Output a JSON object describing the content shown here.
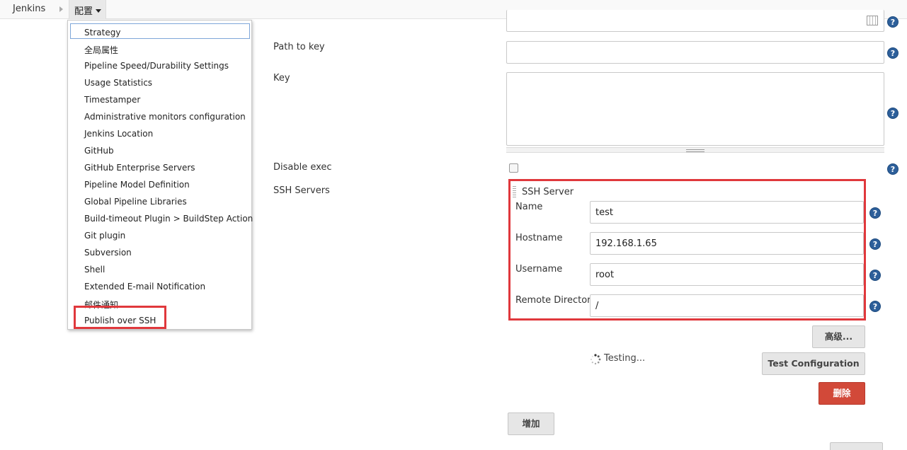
{
  "breadcrumb": {
    "root": "Jenkins",
    "current": "配置"
  },
  "menu": {
    "items": [
      "Strategy",
      "全局属性",
      "Pipeline Speed/Durability Settings",
      "Usage Statistics",
      "Timestamper",
      "Administrative monitors configuration",
      "Jenkins Location",
      "GitHub",
      "GitHub Enterprise Servers",
      "Pipeline Model Definition",
      "Global Pipeline Libraries",
      "Build-timeout Plugin > BuildStep Action",
      "Git plugin",
      "Subversion",
      "Shell",
      "Extended E-mail Notification",
      "邮件通知",
      "Publish over SSH"
    ]
  },
  "form": {
    "path_to_key_label": "Path to key",
    "key_label": "Key",
    "disable_exec_label": "Disable exec",
    "ssh_servers_label": "SSH Servers",
    "path_to_key_value": "",
    "key_value": ""
  },
  "ssh_server": {
    "title": "SSH Server",
    "name_label": "Name",
    "name_value": "test",
    "hostname_label": "Hostname",
    "hostname_value": "192.168.1.65",
    "username_label": "Username",
    "username_value": "root",
    "remote_dir_label": "Remote Directory",
    "remote_dir_value": "/"
  },
  "buttons": {
    "advanced": "高级...",
    "testing_status": "Testing...",
    "test_configuration": "Test Configuration",
    "delete": "删除",
    "add": "增加"
  },
  "help_symbol": "?",
  "colors": {
    "highlight_red": "#e0383c",
    "help_blue": "#2d5f9a",
    "delete_red": "#d24939"
  }
}
